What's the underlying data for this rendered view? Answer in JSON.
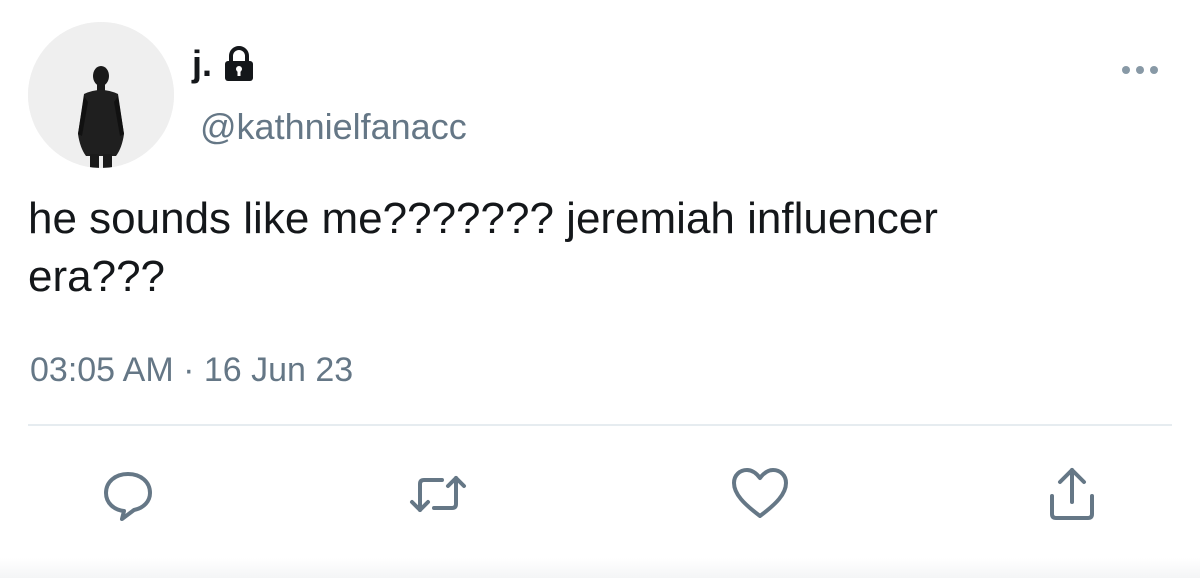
{
  "user": {
    "display_name": "j.",
    "handle": "@kathnielfanacc",
    "protected_icon": "lock-icon",
    "avatar_icon": "avatar-person-silhouette"
  },
  "tweet": {
    "text": "he sounds like me??????? jeremiah influencer\nera???",
    "timestamp": "03:05 AM · 16 Jun 23"
  },
  "actions": [
    {
      "name": "reply",
      "icon": "reply-icon"
    },
    {
      "name": "retweet",
      "icon": "retweet-icon"
    },
    {
      "name": "like",
      "icon": "heart-icon"
    },
    {
      "name": "share",
      "icon": "share-icon"
    }
  ],
  "menu_icon": "more-options-icon",
  "colors": {
    "text": "#14171a",
    "secondary": "#657786",
    "divider": "#e6ecf0"
  }
}
